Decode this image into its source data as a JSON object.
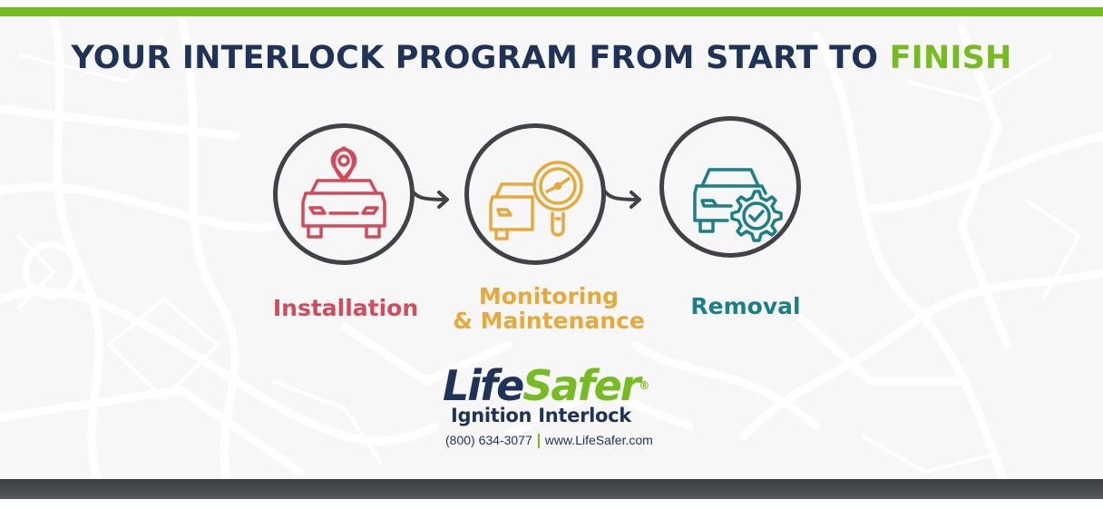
{
  "headline": {
    "prefix": "YOUR INTERLOCK PROGRAM FROM START TO ",
    "accent": "FINISH"
  },
  "steps": [
    {
      "label": "Installation",
      "icon": "car-location-pin-icon",
      "color": "#d14b5a"
    },
    {
      "label_line1": "Monitoring",
      "label_line2": "& Maintenance",
      "icon": "car-magnifier-gauge-icon",
      "color": "#e8a93b"
    },
    {
      "label": "Removal",
      "icon": "car-gear-check-icon",
      "color": "#1a7f86"
    }
  ],
  "logo": {
    "brand_part1": "Life",
    "brand_part2": "Safer",
    "registered": "®",
    "tagline": "Ignition Interlock",
    "phone": "(800) 634-3077",
    "website": "www.LifeSafer.com"
  },
  "colors": {
    "navy": "#1f3257",
    "green": "#76bc21",
    "circle": "#3f4246",
    "footer_bar": "#44474b"
  }
}
